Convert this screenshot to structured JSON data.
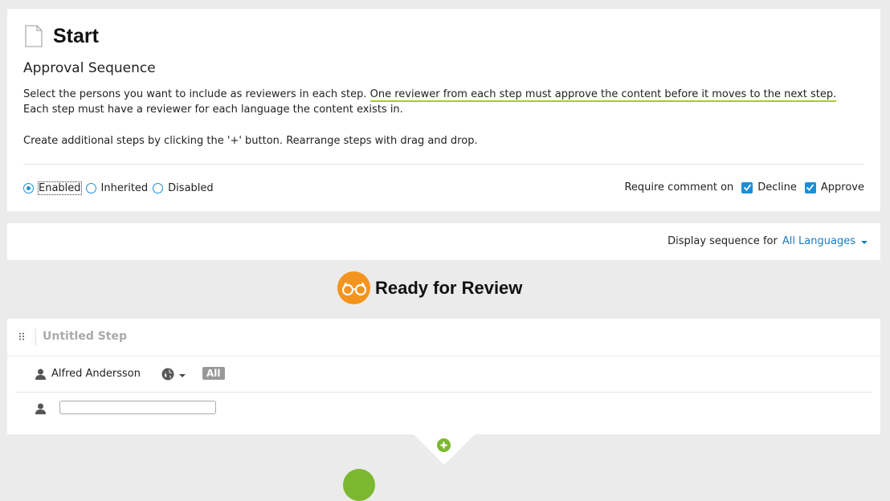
{
  "header": {
    "title": "Start",
    "subtitle": "Approval Sequence",
    "description_part1": "Select the persons you want to include as reviewers in each step. ",
    "description_highlight": "One reviewer from each step must approve the content before it moves to the next step.",
    "description_line2": "Each step must have a reviewer for each language the content exists in.",
    "description_line3": "Create additional steps by clicking the '+' button. Rearrange steps with drag and drop."
  },
  "mode": {
    "options": [
      "Enabled",
      "Inherited",
      "Disabled"
    ],
    "selected": "Enabled"
  },
  "require_comment": {
    "label": "Require comment on",
    "decline_label": "Decline",
    "decline_checked": true,
    "approve_label": "Approve",
    "approve_checked": true
  },
  "sequence": {
    "label": "Display sequence for",
    "language": "All Languages"
  },
  "stage": {
    "title": "Ready for Review"
  },
  "step": {
    "name": "Untitled Step",
    "reviewers": [
      {
        "name": "Alfred Andersson",
        "language_badge": "All"
      }
    ],
    "new_reviewer_value": ""
  },
  "colors": {
    "accent_blue": "#1a8fd8",
    "highlight_green": "#a6cc2a",
    "review_orange": "#f5941d",
    "add_green": "#7cb82f",
    "badge_gray": "#999999"
  },
  "icons": {
    "page": "document-icon",
    "stage": "glasses-icon",
    "drag": "drag-handle-icon",
    "user": "user-icon",
    "language": "globe-icon",
    "add": "plus-circle-icon"
  }
}
